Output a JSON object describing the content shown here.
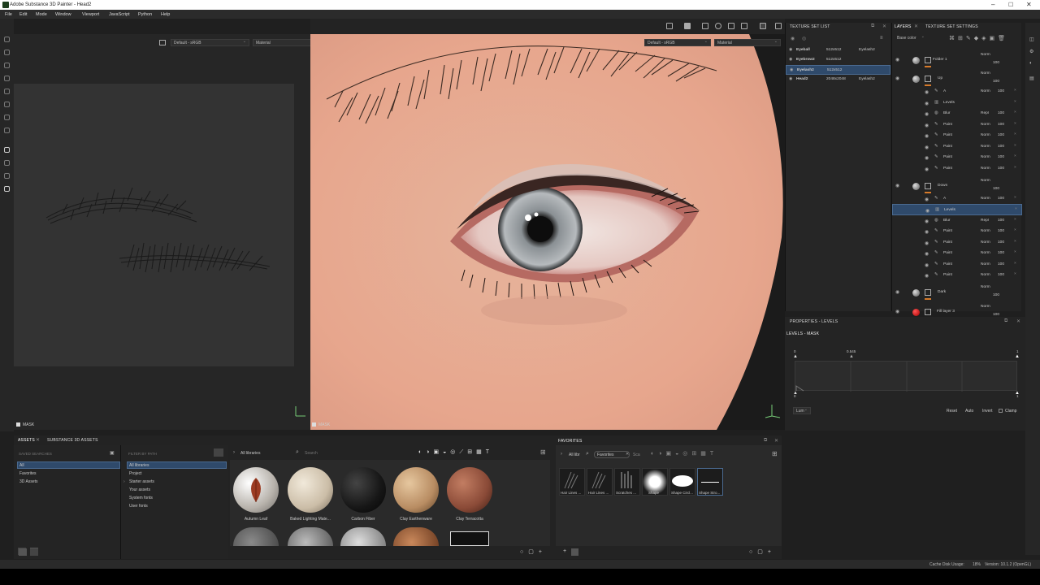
{
  "app": {
    "title": "Adobe Substance 3D Painter - Head2"
  },
  "menu": [
    "File",
    "Edit",
    "Mode",
    "Window",
    "Viewport",
    "JavaScript",
    "Python",
    "Help"
  ],
  "uv_view": {
    "color_profile": "Default - sRGB",
    "channel": "Material",
    "mask_label": "MASK"
  },
  "viewport": {
    "color_profile": "Default - sRGB",
    "channel": "Material",
    "mask_label": "MASK"
  },
  "texture_set_list": {
    "title": "TEXTURE SET LIST",
    "rows": [
      {
        "name": "Eyeball",
        "size": "512x512",
        "extra": "Eyelash2"
      },
      {
        "name": "Eyebrow2",
        "size": "512x512",
        "extra": ""
      },
      {
        "name": "Eyelash2",
        "size": "512x512",
        "extra": ""
      },
      {
        "name": "Head2",
        "size": "2048x2048",
        "extra": "Eyelash2"
      }
    ]
  },
  "layers": {
    "tab_layers": "LAYERS",
    "tab_settings": "TEXTURE SET SETTINGS",
    "channel": "Base color",
    "items": [
      {
        "name": "Folder 1",
        "blend": "Norm",
        "opacity": "100",
        "kind": "folder",
        "indent": 0
      },
      {
        "name": "Up",
        "blend": "Norm",
        "opacity": "100",
        "kind": "group",
        "indent": 0
      },
      {
        "name": "A",
        "blend": "Norm",
        "opacity": "100",
        "kind": "paint",
        "indent": 1
      },
      {
        "name": "Levels",
        "blend": "",
        "opacity": "",
        "kind": "levels",
        "indent": 1
      },
      {
        "name": "Blur",
        "blend": "Repl",
        "opacity": "100",
        "kind": "blur",
        "indent": 1
      },
      {
        "name": "Paint",
        "blend": "Norm",
        "opacity": "100",
        "kind": "paint",
        "indent": 1
      },
      {
        "name": "Paint",
        "blend": "Norm",
        "opacity": "100",
        "kind": "paint",
        "indent": 1
      },
      {
        "name": "Paint",
        "blend": "Norm",
        "opacity": "100",
        "kind": "paint",
        "indent": 1
      },
      {
        "name": "Paint",
        "blend": "Norm",
        "opacity": "100",
        "kind": "paint",
        "indent": 1
      },
      {
        "name": "Paint",
        "blend": "Norm",
        "opacity": "100",
        "kind": "paint",
        "indent": 1
      },
      {
        "name": "Down",
        "blend": "Norm",
        "opacity": "100",
        "kind": "group",
        "indent": 0
      },
      {
        "name": "A",
        "blend": "Norm",
        "opacity": "100",
        "kind": "paint",
        "indent": 1
      },
      {
        "name": "Levels",
        "blend": "",
        "opacity": "",
        "kind": "levels",
        "indent": 1
      },
      {
        "name": "Blur",
        "blend": "Repl",
        "opacity": "100",
        "kind": "blur",
        "indent": 1
      },
      {
        "name": "Paint",
        "blend": "Norm",
        "opacity": "100",
        "kind": "paint",
        "indent": 1
      },
      {
        "name": "Paint",
        "blend": "Norm",
        "opacity": "100",
        "kind": "paint",
        "indent": 1
      },
      {
        "name": "Paint",
        "blend": "Norm",
        "opacity": "100",
        "kind": "paint",
        "indent": 1
      },
      {
        "name": "Paint",
        "blend": "Norm",
        "opacity": "100",
        "kind": "paint",
        "indent": 1
      },
      {
        "name": "Paint",
        "blend": "Norm",
        "opacity": "100",
        "kind": "paint",
        "indent": 1
      },
      {
        "name": "Dark",
        "blend": "Norm",
        "opacity": "100",
        "kind": "group",
        "indent": 0
      },
      {
        "name": "Fill layer 3",
        "blend": "Norm",
        "opacity": "100",
        "kind": "fill",
        "indent": 0
      }
    ]
  },
  "properties": {
    "title": "PROPERTIES - LEVELS",
    "subtitle": "LEVELS - MASK",
    "top_values": [
      "0",
      "0.545",
      "1"
    ],
    "bottom_values": [
      "0",
      "1"
    ],
    "mode": "Lum",
    "buttons": [
      "Reset",
      "Auto",
      "Invert",
      "Clamp"
    ]
  },
  "assets": {
    "tab_assets": "ASSETS",
    "tab_substance": "SUBSTANCE 3D ASSETS",
    "saved_searches_label": "SAVED SEARCHES",
    "filter_label": "FILTER BY PATH",
    "saved": [
      "All",
      "Favorites",
      "3D Assets"
    ],
    "paths": [
      "All libraries",
      "Project",
      "Starter assets",
      "Your assets",
      "System fonts",
      "User fonts"
    ],
    "breadcrumb": "All libraries",
    "search_placeholder": "Search",
    "materials": [
      {
        "label": "Autumn Leaf",
        "color": "#c9c4bd"
      },
      {
        "label": "Baked Lighting Mate...",
        "color": "#cbbda7"
      },
      {
        "label": "Carbon Fiber",
        "color": "#1a1a1a"
      },
      {
        "label": "Clay Earthenware",
        "color": "#b88c62"
      },
      {
        "label": "Clay Terracotta",
        "color": "#8a4a37"
      }
    ]
  },
  "favorites": {
    "title": "FAVORITES",
    "breadcrumb": "All libr",
    "filter": "Favorites",
    "search": "Sca",
    "items": [
      "Hair Lines ...",
      "Hair Lines ...",
      "Scratches ...",
      "Shape",
      "Shape Circl...",
      "Shape Stro..."
    ]
  },
  "status": {
    "cache": "Cache Disk Usage:",
    "percent": "18%",
    "version": "Version: 10.1.2 (OpenGL)"
  }
}
